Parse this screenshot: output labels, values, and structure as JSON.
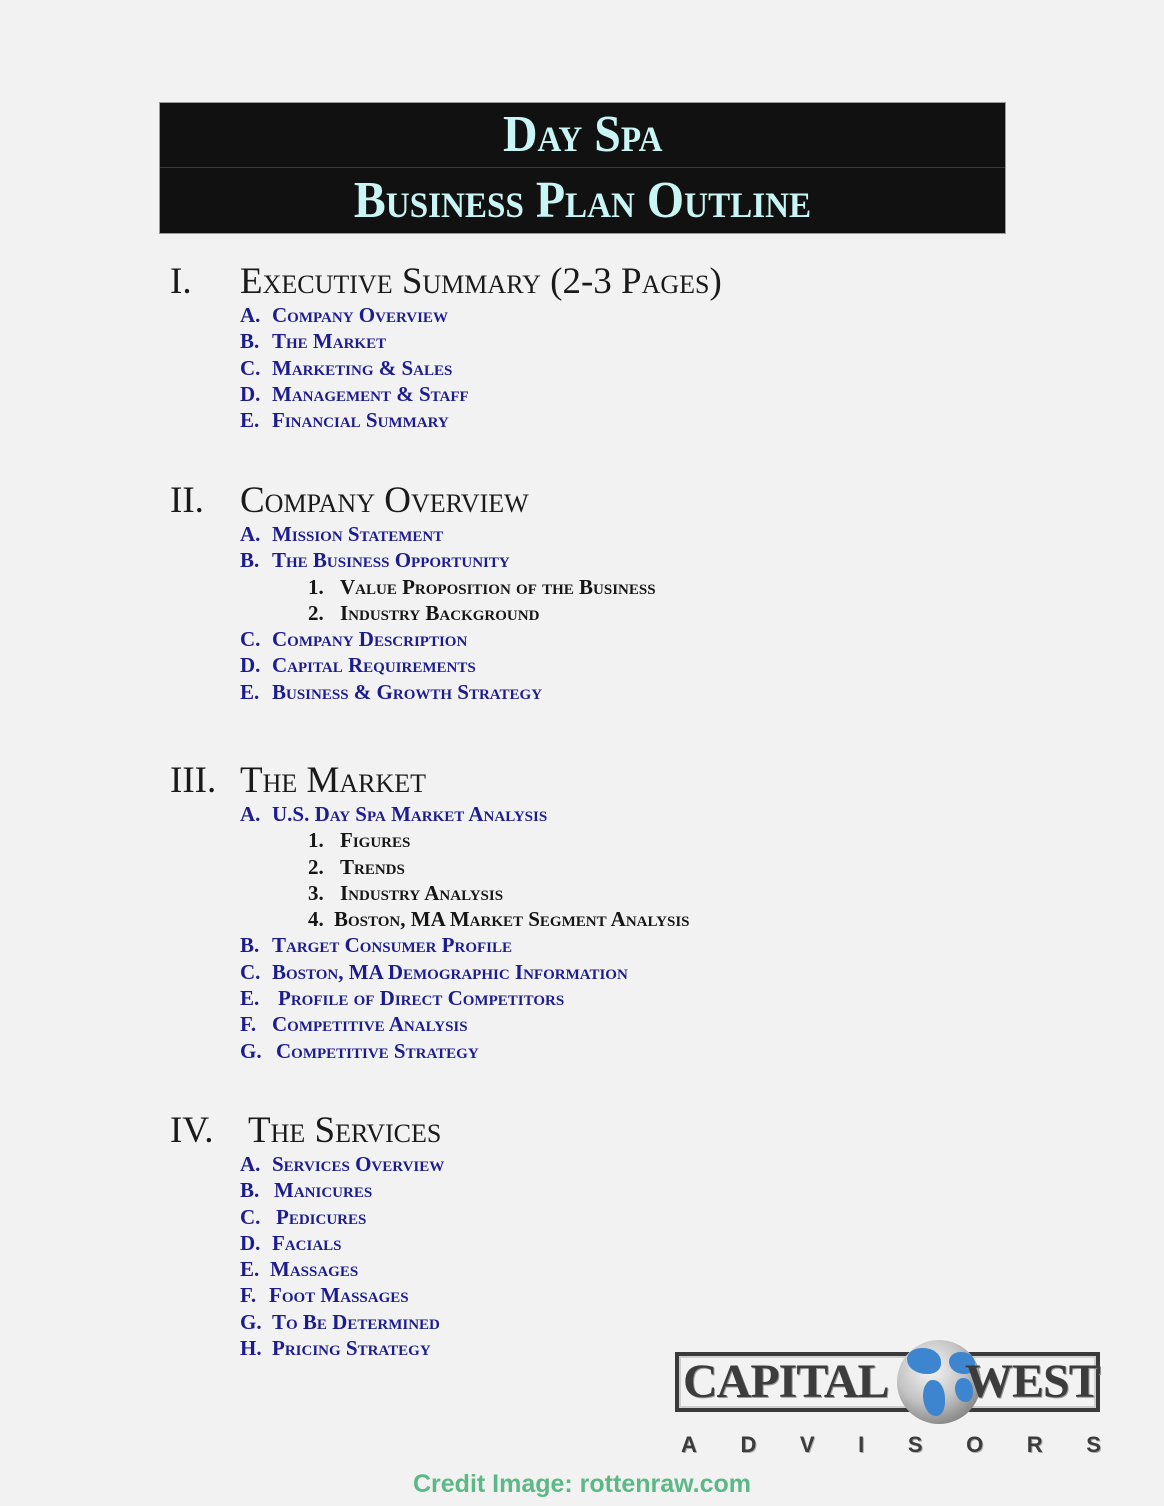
{
  "header": {
    "line1": "Day Spa",
    "line2": "Business Plan Outline"
  },
  "sections": [
    {
      "num": "I.",
      "title": "Executive Summary (2-3 Pages)",
      "items": [
        {
          "label": "A.",
          "text": "Company Overview"
        },
        {
          "label": "B.",
          "text": "The Market"
        },
        {
          "label": "C.",
          "text": "Marketing & Sales"
        },
        {
          "label": "D.",
          "text": "Management & Staff"
        },
        {
          "label": "E.",
          "text": "Financial Summary"
        }
      ]
    },
    {
      "num": "II.",
      "title": "Company Overview",
      "items": [
        {
          "label": "A.",
          "text": "Mission Statement"
        },
        {
          "label": "B.",
          "text": "The Business Opportunity"
        },
        {
          "label": "1.",
          "text": "Value Proposition of the Business"
        },
        {
          "label": "2.",
          "text": "Industry Background"
        },
        {
          "label": "C.",
          "text": "Company Description"
        },
        {
          "label": "D.",
          "text": "Capital Requirements"
        },
        {
          "label": "E.",
          "text": "Business & Growth Strategy"
        }
      ]
    },
    {
      "num": "III.",
      "title": "The Market",
      "items": [
        {
          "label": "A.",
          "text": "U.S. Day Spa Market Analysis"
        },
        {
          "label": "1.",
          "text": "Figures"
        },
        {
          "label": "2.",
          "text": "Trends"
        },
        {
          "label": "3.",
          "text": "Industry Analysis"
        },
        {
          "label": "4.",
          "text": "Boston, MA Market Segment Analysis"
        },
        {
          "label": "B.",
          "text": "Target Consumer Profile"
        },
        {
          "label": "C.",
          "text": "Boston, MA Demographic Information"
        },
        {
          "label": "E.",
          "text": "Profile of Direct Competitors"
        },
        {
          "label": "F.",
          "text": "Competitive Analysis"
        },
        {
          "label": "G.",
          "text": "Competitive Strategy"
        }
      ]
    },
    {
      "num": "IV.",
      "title": "The Services",
      "items": [
        {
          "label": "A.",
          "text": "Services Overview"
        },
        {
          "label": "B.",
          "text": "Manicures"
        },
        {
          "label": "C.",
          "text": "Pedicures"
        },
        {
          "label": "D.",
          "text": "Facials"
        },
        {
          "label": "E.",
          "text": "Massages"
        },
        {
          "label": "F.",
          "text": "Foot Massages"
        },
        {
          "label": "G.",
          "text": "To Be Determined"
        },
        {
          "label": "H.",
          "text": "Pricing Strategy"
        }
      ]
    }
  ],
  "logo": {
    "word1": "CAPITAL",
    "word2": "WEST",
    "tagline": [
      "A",
      "D",
      "V",
      "I",
      "S",
      "O",
      "R",
      "S"
    ]
  },
  "credit": "Credit Image: rottenraw.com",
  "colors": {
    "header_bg": "#111111",
    "header_text": "#c9f5f4",
    "item_blue": "#1c1c8e",
    "credit_green": "#5cb887"
  }
}
